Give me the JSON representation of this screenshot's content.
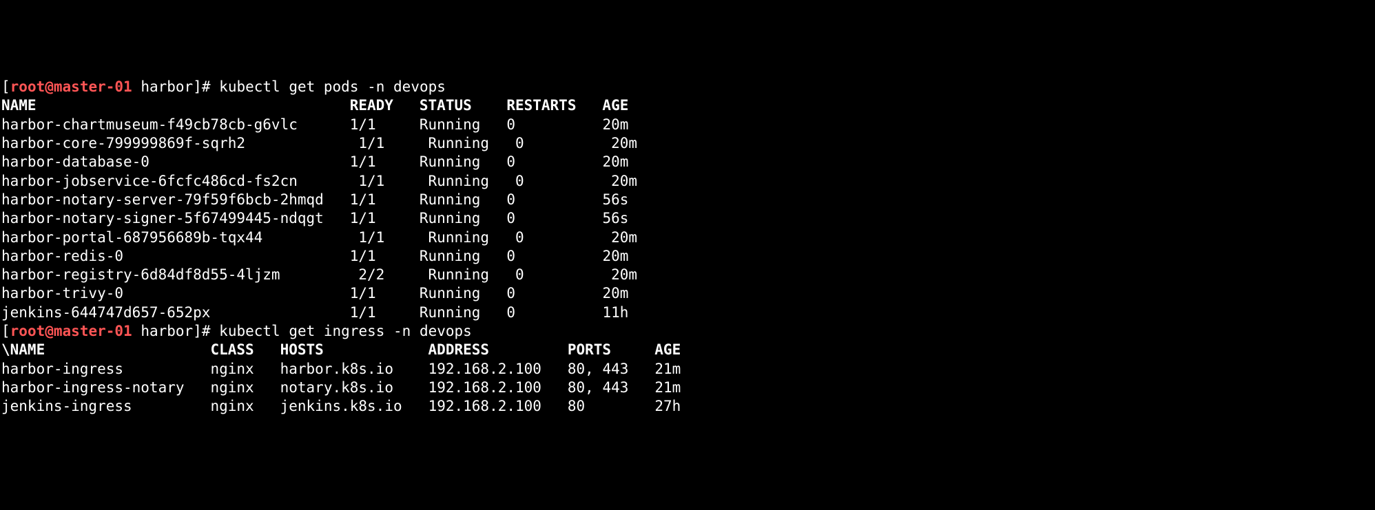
{
  "prompt": {
    "user": "root",
    "host": "master-01",
    "path": "harbor",
    "symbol": "#"
  },
  "commands": {
    "cmd1": "kubectl get pods -n devops",
    "cmd2": "kubectl get ingress -n devops"
  },
  "pods": {
    "headers": {
      "name": "NAME",
      "ready": "READY",
      "status": "STATUS",
      "restarts": "RESTARTS",
      "age": "AGE"
    },
    "rows": [
      {
        "name": "harbor-chartmuseum-f49cb78cb-g6vlc",
        "ready": "1/1",
        "status": "Running",
        "restarts": "0",
        "age": "20m"
      },
      {
        "name": "harbor-core-799999869f-sqrh2",
        "ready": "1/1",
        "status": "Running",
        "restarts": "0",
        "age": "20m"
      },
      {
        "name": "harbor-database-0",
        "ready": "1/1",
        "status": "Running",
        "restarts": "0",
        "age": "20m"
      },
      {
        "name": "harbor-jobservice-6fcfc486cd-fs2cn",
        "ready": "1/1",
        "status": "Running",
        "restarts": "0",
        "age": "20m"
      },
      {
        "name": "harbor-notary-server-79f59f6bcb-2hmqd",
        "ready": "1/1",
        "status": "Running",
        "restarts": "0",
        "age": "56s"
      },
      {
        "name": "harbor-notary-signer-5f67499445-ndqgt",
        "ready": "1/1",
        "status": "Running",
        "restarts": "0",
        "age": "56s"
      },
      {
        "name": "harbor-portal-687956689b-tqx44",
        "ready": "1/1",
        "status": "Running",
        "restarts": "0",
        "age": "20m"
      },
      {
        "name": "harbor-redis-0",
        "ready": "1/1",
        "status": "Running",
        "restarts": "0",
        "age": "20m"
      },
      {
        "name": "harbor-registry-6d84df8d55-4ljzm",
        "ready": "2/2",
        "status": "Running",
        "restarts": "0",
        "age": "20m"
      },
      {
        "name": "harbor-trivy-0",
        "ready": "1/1",
        "status": "Running",
        "restarts": "0",
        "age": "20m"
      },
      {
        "name": "jenkins-644747d657-652px",
        "ready": "1/1",
        "status": "Running",
        "restarts": "0",
        "age": "11h"
      }
    ]
  },
  "ingress": {
    "headers": {
      "name": "\\NAME",
      "class": "CLASS",
      "hosts": "HOSTS",
      "address": "ADDRESS",
      "ports": "PORTS",
      "age": "AGE"
    },
    "rows": [
      {
        "name": "harbor-ingress",
        "class": "nginx",
        "hosts": "harbor.k8s.io",
        "address": "192.168.2.100",
        "ports": "80, 443",
        "age": "21m"
      },
      {
        "name": "harbor-ingress-notary",
        "class": "nginx",
        "hosts": "notary.k8s.io",
        "address": "192.168.2.100",
        "ports": "80, 443",
        "age": "21m"
      },
      {
        "name": "jenkins-ingress",
        "class": "nginx",
        "hosts": "jenkins.k8s.io",
        "address": "192.168.2.100",
        "ports": "80",
        "age": "27h"
      }
    ]
  }
}
